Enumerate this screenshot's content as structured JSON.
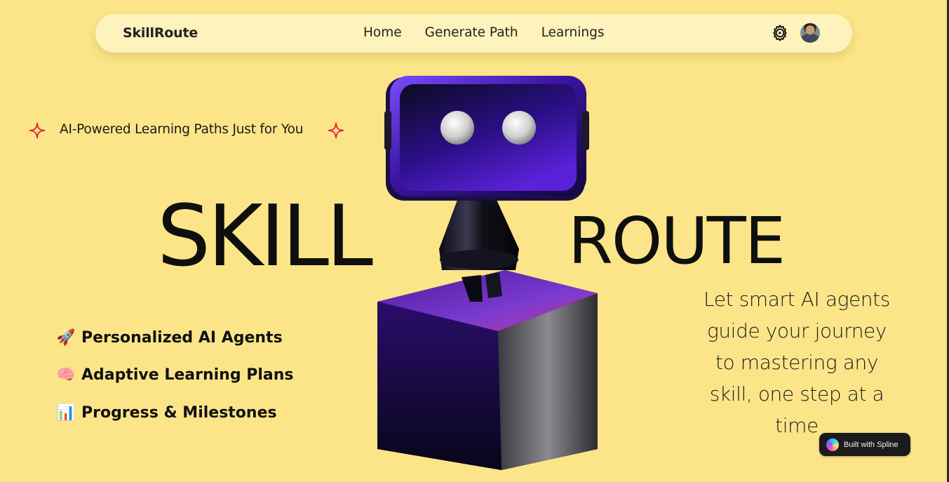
{
  "navbar": {
    "brand": "SkillRoute",
    "links": [
      {
        "label": "Home"
      },
      {
        "label": "Generate Path"
      },
      {
        "label": "Learnings"
      }
    ]
  },
  "hero": {
    "tagline": "AI-Powered Learning Paths Just for You",
    "title_left": "SKILL",
    "title_right": "ROUTE",
    "features": [
      {
        "icon": "🚀",
        "label": "Personalized AI Agents"
      },
      {
        "icon": "🧠",
        "label": "Adaptive Learning Plans"
      },
      {
        "icon": "📊",
        "label": "Progress & Milestones"
      }
    ],
    "description": "Let smart AI agents guide your journey to mastering any skill, one step at a time"
  },
  "badge": {
    "label": "Built with Spline"
  },
  "colors": {
    "background": "#FCE589",
    "navbar": "#FEF2BD",
    "sparkle": "#E0203C",
    "robot_purple": "#4a1fa8"
  },
  "icons": {
    "settings": "gear-icon",
    "sparkle": "four-point-star-icon"
  }
}
